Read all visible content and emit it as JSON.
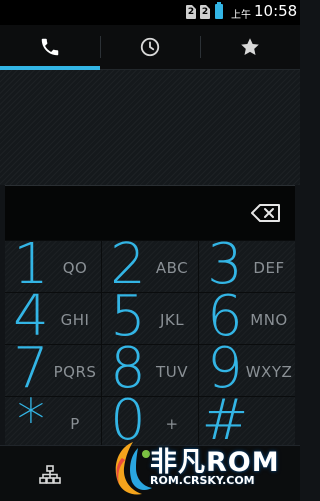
{
  "status_bar": {
    "sim1_label": "2",
    "sim2_label": "2",
    "ampm": "上午",
    "time": "10:58",
    "accent": "#33b5e5"
  },
  "tabs": [
    {
      "icon": "phone-icon",
      "selected": true
    },
    {
      "icon": "clock-icon",
      "selected": false
    },
    {
      "icon": "star-icon",
      "selected": false
    }
  ],
  "dial_field": {
    "value": "",
    "backspace_icon": "backspace-icon"
  },
  "keypad": [
    {
      "digit": "1",
      "letters": "QO"
    },
    {
      "digit": "2",
      "letters": "ABC"
    },
    {
      "digit": "3",
      "letters": "DEF"
    },
    {
      "digit": "4",
      "letters": "GHI"
    },
    {
      "digit": "5",
      "letters": "JKL"
    },
    {
      "digit": "6",
      "letters": "MNO"
    },
    {
      "digit": "7",
      "letters": "PQRS"
    },
    {
      "digit": "8",
      "letters": "TUV"
    },
    {
      "digit": "9",
      "letters": "WXYZ"
    },
    {
      "digit": "*",
      "letters": "P"
    },
    {
      "digit": "0",
      "letters": "+"
    },
    {
      "digit": "#",
      "letters": ""
    }
  ],
  "bottom_bar": {
    "left_icon": "hierarchy-icon"
  },
  "watermark": {
    "title_cn": "非凡",
    "title_rom": "ROM",
    "url": "ROM.CRSKY.COM"
  }
}
